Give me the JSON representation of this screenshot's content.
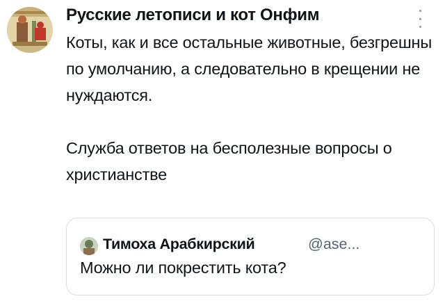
{
  "tweet": {
    "author_name": "Русские летописи и кот Онфим",
    "paragraphs": [
      "Коты, как и все остальные животные, безгрешны по умолчанию, а следовательно в крещении не нуждаются.",
      "Служба ответов на бесполезные вопросы о христианстве"
    ],
    "more_icon": "vertical-ellipsis-icon"
  },
  "quoted_tweet": {
    "author_name": "Тимоха Арабкирский",
    "handle": "@ase...",
    "text": "Можно ли покрестить кота?"
  },
  "colors": {
    "text": "#0f1419",
    "secondary_text": "#536471",
    "border": "#d8dde1",
    "icon": "#8b98a5"
  }
}
